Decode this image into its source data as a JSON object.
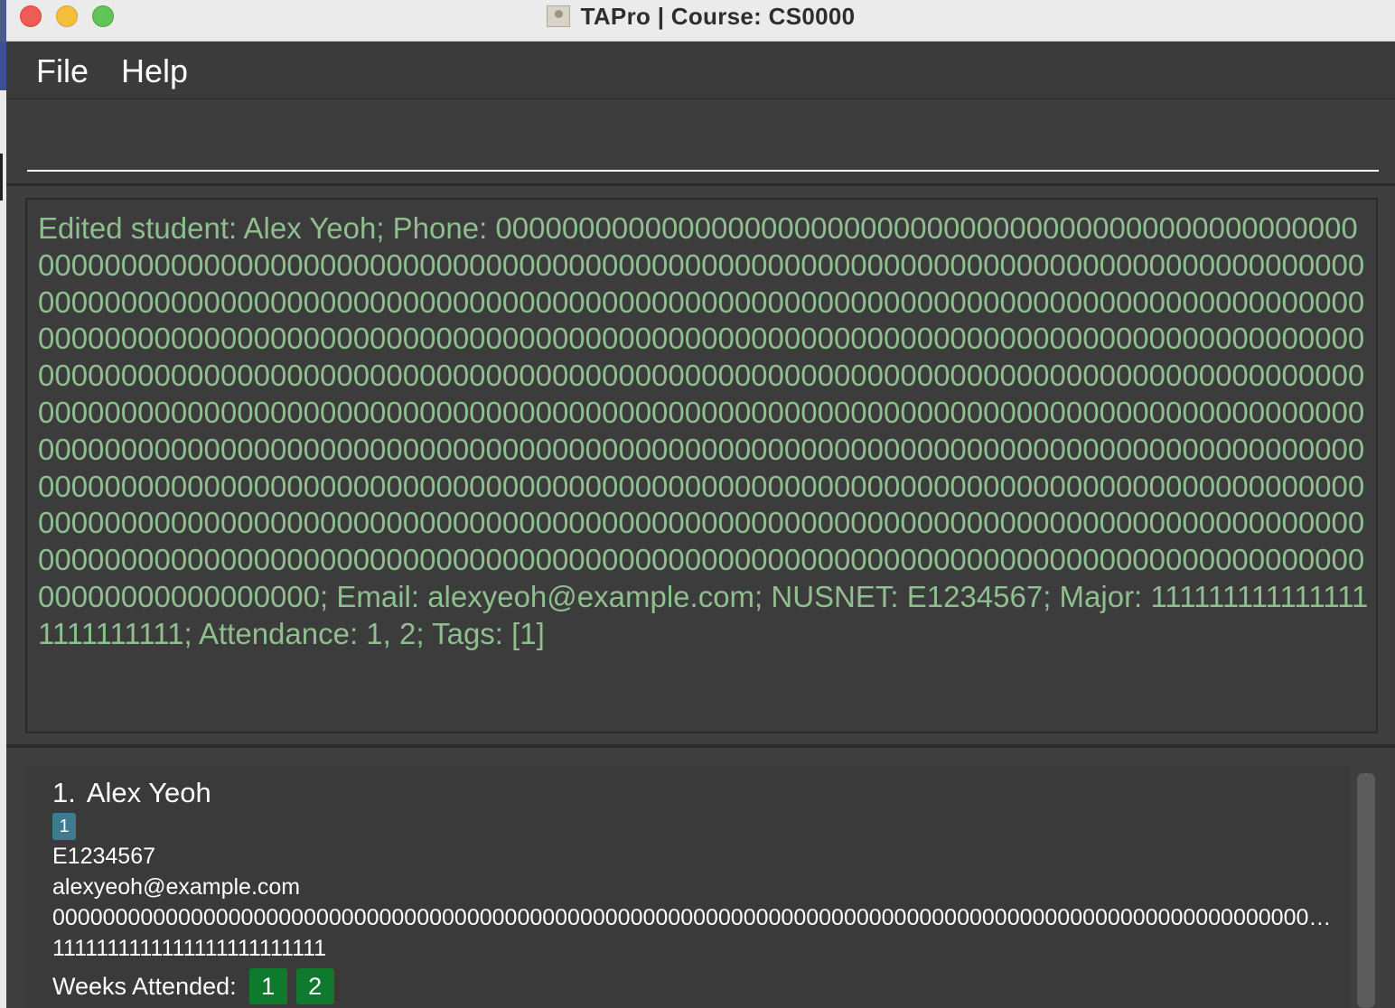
{
  "window": {
    "title": "TAPro | Course: CS0000",
    "app_icon": "address-book-icon"
  },
  "menu": {
    "file": "File",
    "help": "Help"
  },
  "command_box": {
    "value": "",
    "placeholder": ""
  },
  "result_display": {
    "text": "Edited student: Alex Yeoh; Phone: 000000000000000000000000000000000000000000000000000000000000000000000000000000000000000000000000000000000000000000000000000000000000000000000000000000000000000000000000000000000000000000000000000000000000000000000000000000000000000000000000000000000000000000000000000000000000000000000000000000000000000000000000000000000000000000000000000000000000000000000000000000000000000000000000000000000000000000000000000000000000000000000000000000000000000000000000000000000000000000000000000000000000000000000000000000000000000000000000000000000000000000000000000000000000000000000000000000000000000000000000000000000000000000000000000000000000000000000000000000000000000000000000000000000000000000000000000000000000000000000000000000000000000000000000000000000000000000000000000000000000000000000; Email: alexyeoh@example.com; NUSNET: E1234567; Major: 1111111111111111111111111; Attendance: 1, 2; Tags: [1]",
    "color": "#8fbe8f"
  },
  "students": [
    {
      "index": "1.",
      "name": "Alex Yeoh",
      "tags": [
        "1"
      ],
      "nusnet": "E1234567",
      "email": "alexyeoh@example.com",
      "phone": "000000000000000000000000000000000000000000000000000000000000000000000000000000000000000000000000000000000000000000000000000000000000000000000000000000000000000000000000000000000000000000000000000000000000000000000000000000000000000000000000000000000000000000000000000000000000000000000000000000000000000000000000000000000000000000000000000000000000000000000000000000000000000000000000000000000000000000000000000000000000000000000000000000000000000000000000000000000000000000000000000000000000000000000000000000000000000000000000000000000000000000000000000000000000000000000000000000000000000000000000000000000000000000000000000000000000000000000000000000000000000000000000000000000000000000000000000000000000000000000000000000000000000000000000000000000000000000000000000000000000000000000000",
      "major": "1111111111111111111111111",
      "weeks_label": "Weeks Attended:",
      "weeks": [
        "1",
        "2"
      ]
    }
  ],
  "colors": {
    "tag": "#3e7b91",
    "week_badge": "#0f7a2e",
    "window_bg": "#3f3f3f"
  }
}
